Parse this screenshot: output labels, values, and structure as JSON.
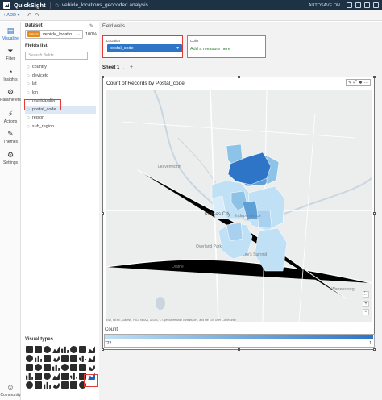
{
  "topbar": {
    "app": "QuickSight",
    "title": "vehicle_locations_geocoded analysis",
    "autosave": "AUTOSAVE ON"
  },
  "toolbar": {
    "add": "+ ADD ▾",
    "undo": "↶",
    "redo": "↷"
  },
  "rail": {
    "items": [
      {
        "label": "Visualize",
        "icon": "▤"
      },
      {
        "label": "Filter",
        "icon": "⏷"
      },
      {
        "label": "Insights",
        "icon": "◔"
      },
      {
        "label": "Parameters",
        "icon": "⚙"
      },
      {
        "label": "Actions",
        "icon": "⚡"
      },
      {
        "label": "Themes",
        "icon": "✎"
      },
      {
        "label": "Settings",
        "icon": "⚙"
      },
      {
        "label": "Community",
        "icon": "☺"
      }
    ]
  },
  "data_panel": {
    "dataset_label": "Dataset",
    "spice_badge": "SPICE",
    "dataset_name": "vehicle_locatio...",
    "spice_percent": "100%",
    "fields_label": "Fields list",
    "search_placeholder": "Search fields",
    "fields": [
      "country",
      "devicetd",
      "lat",
      "lon",
      "municipality",
      "postal_code",
      "region",
      "sub_region"
    ],
    "selected_field": "postal_code",
    "visual_types_label": "Visual types"
  },
  "field_wells": {
    "label": "Field wells",
    "location_label": "Location",
    "location_value": "postal_code",
    "color_label": "Color",
    "color_add": "Add a measure here"
  },
  "sheet": {
    "name": "Sheet 1"
  },
  "visual": {
    "title": "Count of Records by Postal_code",
    "legend_title": "Count",
    "legend_min": "722",
    "legend_max": "1",
    "attribution": "Esri, HERE, Garmin, FAO, NOAA, USGS, © OpenStreetMap contributors, and the GIS User Community",
    "color_low": "#bfe0f5",
    "color_high": "#2e75c7",
    "map_labels": [
      "Leavenworth",
      "Kansas City",
      "Independence",
      "Overland Park",
      "Lee's Summit",
      "Olathe",
      "Warrensburg"
    ],
    "zoom_in": "+",
    "zoom_out": "−"
  }
}
